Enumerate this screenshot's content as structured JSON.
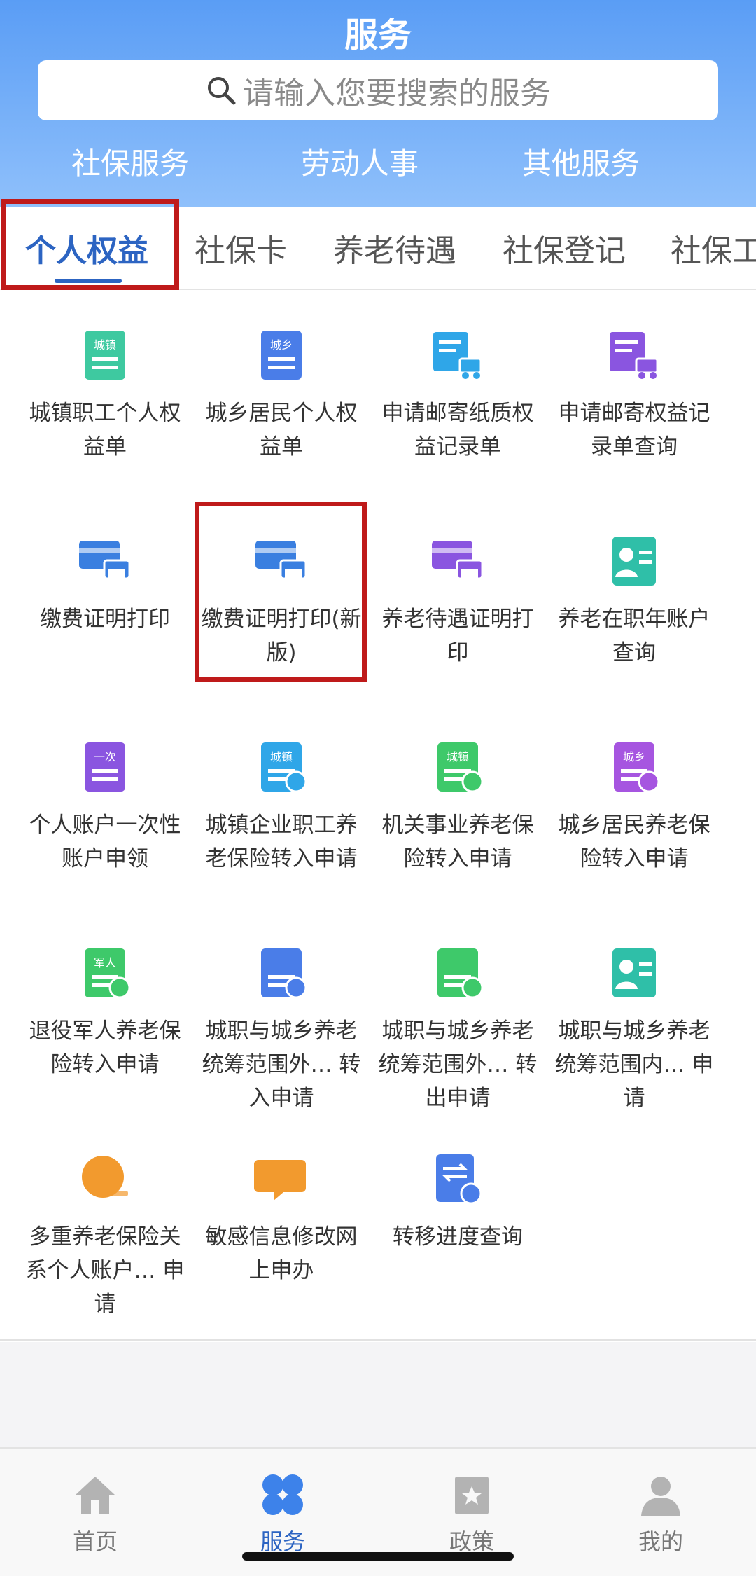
{
  "header": {
    "title": "服务",
    "search_placeholder": "请输入您要搜索的服务",
    "top_tabs": [
      "社保服务",
      "劳动人事",
      "其他服务"
    ]
  },
  "category_tabs": [
    "个人权益",
    "社保卡",
    "养老待遇",
    "社保登记",
    "社保工"
  ],
  "active_category": "个人权益",
  "services": [
    {
      "label": "城镇职工个人权益单",
      "icon": "urban-doc-icon",
      "color": "#3ec9a0",
      "badge": "城镇"
    },
    {
      "label": "城乡居民个人权益单",
      "icon": "rural-doc-icon",
      "color": "#4a7de8",
      "badge": "城乡"
    },
    {
      "label": "申请邮寄纸质权益记录单",
      "icon": "mail-truck-icon",
      "color": "#2fa6e8",
      "badge": ""
    },
    {
      "label": "申请邮寄权益记录单查询",
      "icon": "truck-search-icon",
      "color": "#8a55e0",
      "badge": ""
    },
    {
      "label": "缴费证明打印",
      "icon": "card-printer-icon",
      "color": "#3a7fe0",
      "badge": ""
    },
    {
      "label": "缴费证明打印(新版)",
      "icon": "card-printer-new-icon",
      "color": "#3a7fe0",
      "badge": ""
    },
    {
      "label": "养老待遇证明打印",
      "icon": "pension-printer-icon",
      "color": "#8a55e0",
      "badge": ""
    },
    {
      "label": "养老在职年账户查询",
      "icon": "person-list-icon",
      "color": "#2fbfa8",
      "badge": ""
    },
    {
      "label": "个人账户一次性账户申领",
      "icon": "one-time-icon",
      "color": "#8a55e0",
      "badge": "一次"
    },
    {
      "label": "城镇企业职工养老保险转入申请",
      "icon": "urban-transfer-in-icon",
      "color": "#2fa6e8",
      "badge": "城镇"
    },
    {
      "label": "机关事业养老保险转入申请",
      "icon": "org-transfer-in-icon",
      "color": "#3ec96a",
      "badge": "城镇"
    },
    {
      "label": "城乡居民养老保险转入申请",
      "icon": "rural-transfer-in-icon",
      "color": "#a655e0",
      "badge": "城乡"
    },
    {
      "label": "退役军人养老保险转入申请",
      "icon": "veteran-transfer-in-icon",
      "color": "#3ec96a",
      "badge": "军人"
    },
    {
      "label": "城职与城乡养老统筹范围外… 转入申请",
      "icon": "coordination-in-icon",
      "color": "#4a7de8",
      "badge": ""
    },
    {
      "label": "城职与城乡养老统筹范围外… 转出申请",
      "icon": "coordination-out-icon",
      "color": "#3ec96a",
      "badge": ""
    },
    {
      "label": "城职与城乡养老统筹范围内… 申请",
      "icon": "coordination-edit-icon",
      "color": "#2fbfa8",
      "badge": ""
    },
    {
      "label": "多重养老保险关系个人账户… 申请",
      "icon": "yuan-coin-icon",
      "color": "#f29a2e",
      "badge": "¥"
    },
    {
      "label": "敏感信息修改网上申办",
      "icon": "chat-password-icon",
      "color": "#f29a2e",
      "badge": "***"
    },
    {
      "label": "转移进度查询",
      "icon": "transfer-progress-icon",
      "color": "#4a7de8",
      "badge": ""
    }
  ],
  "bottom_nav": [
    {
      "label": "首页",
      "icon": "home-icon"
    },
    {
      "label": "服务",
      "icon": "services-icon"
    },
    {
      "label": "政策",
      "icon": "policy-icon"
    },
    {
      "label": "我的",
      "icon": "profile-icon"
    }
  ],
  "colors": {
    "accent": "#2c64c2",
    "header_top": "#5a9df5",
    "highlight": "#bf1a1a"
  }
}
